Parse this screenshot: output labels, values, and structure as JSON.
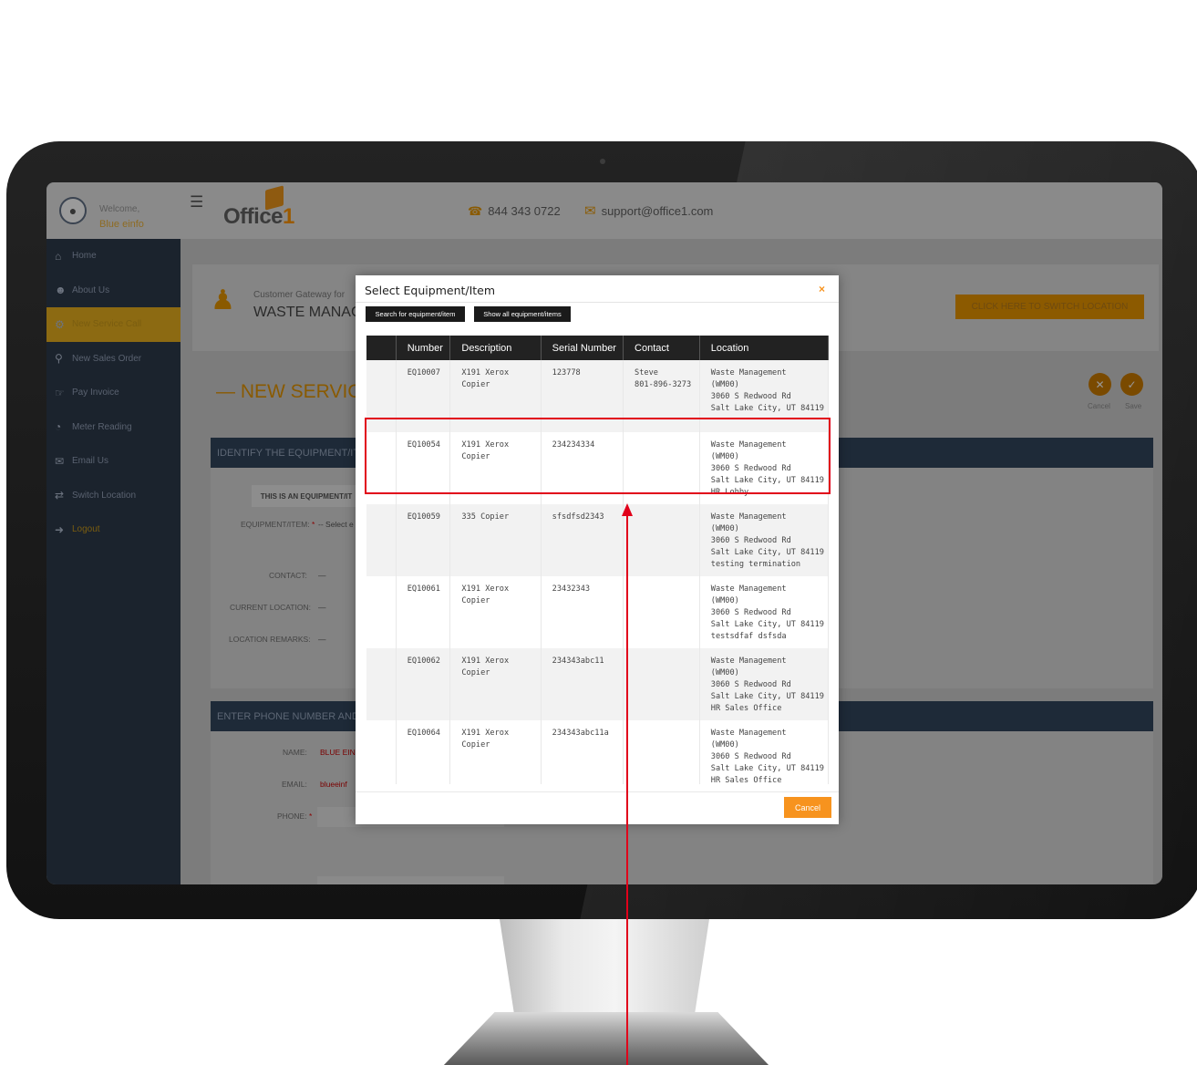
{
  "header": {
    "welcome": "Welcome,",
    "user_name": "Blue einfo",
    "logo_text": "Office",
    "logo_num": "1",
    "phone": "844 343 0722",
    "email": "support@office1.com"
  },
  "sidebar": {
    "items": [
      {
        "label": "Home",
        "icon": "home-icon"
      },
      {
        "label": "About Us",
        "icon": "user-icon"
      },
      {
        "label": "New Service Call",
        "icon": "service-icon"
      },
      {
        "label": "New Sales Order",
        "icon": "sales-icon"
      },
      {
        "label": "Pay Invoice",
        "icon": "pay-icon"
      },
      {
        "label": "Meter Reading",
        "icon": "meter-icon"
      },
      {
        "label": "Email Us",
        "icon": "mail-icon"
      },
      {
        "label": "Switch Location",
        "icon": "switch-icon"
      },
      {
        "label": "Logout",
        "icon": "logout-icon"
      }
    ]
  },
  "gateway": {
    "label": "Customer Gateway for",
    "customer": "WASTE MANAGE",
    "switch_btn": "CLICK HERE TO SWITCH LOCATION"
  },
  "page": {
    "title": "— NEW SERVICE",
    "cancel_label": "Cancel",
    "save_label": "Save"
  },
  "section1": {
    "heading": "IDENTIFY THE EQUIPMENT/ITEM",
    "equip_box": "THIS IS AN EQUIPMENT/IT",
    "equip_label": "EQUIPMENT/ITEM:",
    "equip_value": "-- Select e",
    "contact_label": "CONTACT:",
    "contact_value": "—",
    "loc_label": "CURRENT LOCATION:",
    "loc_value": "—",
    "remarks_label": "LOCATION REMARKS:",
    "remarks_value": "—"
  },
  "section2": {
    "heading": "ENTER PHONE NUMBER AND C",
    "name_label": "NAME:",
    "name_value": "BLUE EIN",
    "email_label": "EMAIL:",
    "email_value": "blueeinf",
    "phone_label": "PHONE:"
  },
  "modal": {
    "title": "Select Equipment/Item",
    "close": "×",
    "search_btn": "Search for equipment/item",
    "show_all_btn": "Show all equipment/items",
    "cancel_btn": "Cancel",
    "columns": [
      "",
      "Number",
      "Description",
      "Serial Number",
      "Contact",
      "Location"
    ],
    "rows": [
      {
        "number": "EQ10007",
        "desc": [
          "X191 Xerox",
          "Copier"
        ],
        "serial": "123778",
        "contact": [
          "Steve",
          "801-896-3273"
        ],
        "location": [
          "Waste Management",
          "(WM00)",
          "3060 S Redwood Rd",
          "Salt Lake City, UT 84119"
        ]
      },
      {
        "number": "EQ10054",
        "desc": [
          "X191 Xerox",
          "Copier"
        ],
        "serial": "234234334",
        "contact": [],
        "location": [
          "Waste Management",
          "(WM00)",
          "3060 S Redwood Rd",
          "Salt Lake City, UT 84119",
          "HR Lobby"
        ]
      },
      {
        "number": "EQ10059",
        "desc": [
          "335 Copier"
        ],
        "serial": "sfsdfsd2343",
        "contact": [],
        "location": [
          "Waste Management",
          "(WM00)",
          "3060 S Redwood Rd",
          "Salt Lake City, UT 84119",
          "testing termination"
        ]
      },
      {
        "number": "EQ10061",
        "desc": [
          "X191 Xerox",
          "Copier"
        ],
        "serial": "23432343",
        "contact": [],
        "location": [
          "Waste Management",
          "(WM00)",
          "3060 S Redwood Rd",
          "Salt Lake City, UT 84119",
          "testsdfaf dsfsda"
        ]
      },
      {
        "number": "EQ10062",
        "desc": [
          "X191 Xerox",
          "Copier"
        ],
        "serial": "234343abc11",
        "contact": [],
        "location": [
          "Waste Management",
          "(WM00)",
          "3060 S Redwood Rd",
          "Salt Lake City, UT 84119",
          "HR Sales Office"
        ]
      },
      {
        "number": "EQ10064",
        "desc": [
          "X191 Xerox",
          "Copier"
        ],
        "serial": "234343abc11a",
        "contact": [],
        "location": [
          "Waste Management",
          "(WM00)",
          "3060 S Redwood Rd",
          "Salt Lake City, UT 84119",
          "HR Sales Office"
        ]
      }
    ]
  },
  "colors": {
    "accent": "#f7931e",
    "highlight": "#e1001a",
    "table_header": "#222222",
    "sidebar": "#1b232d"
  }
}
